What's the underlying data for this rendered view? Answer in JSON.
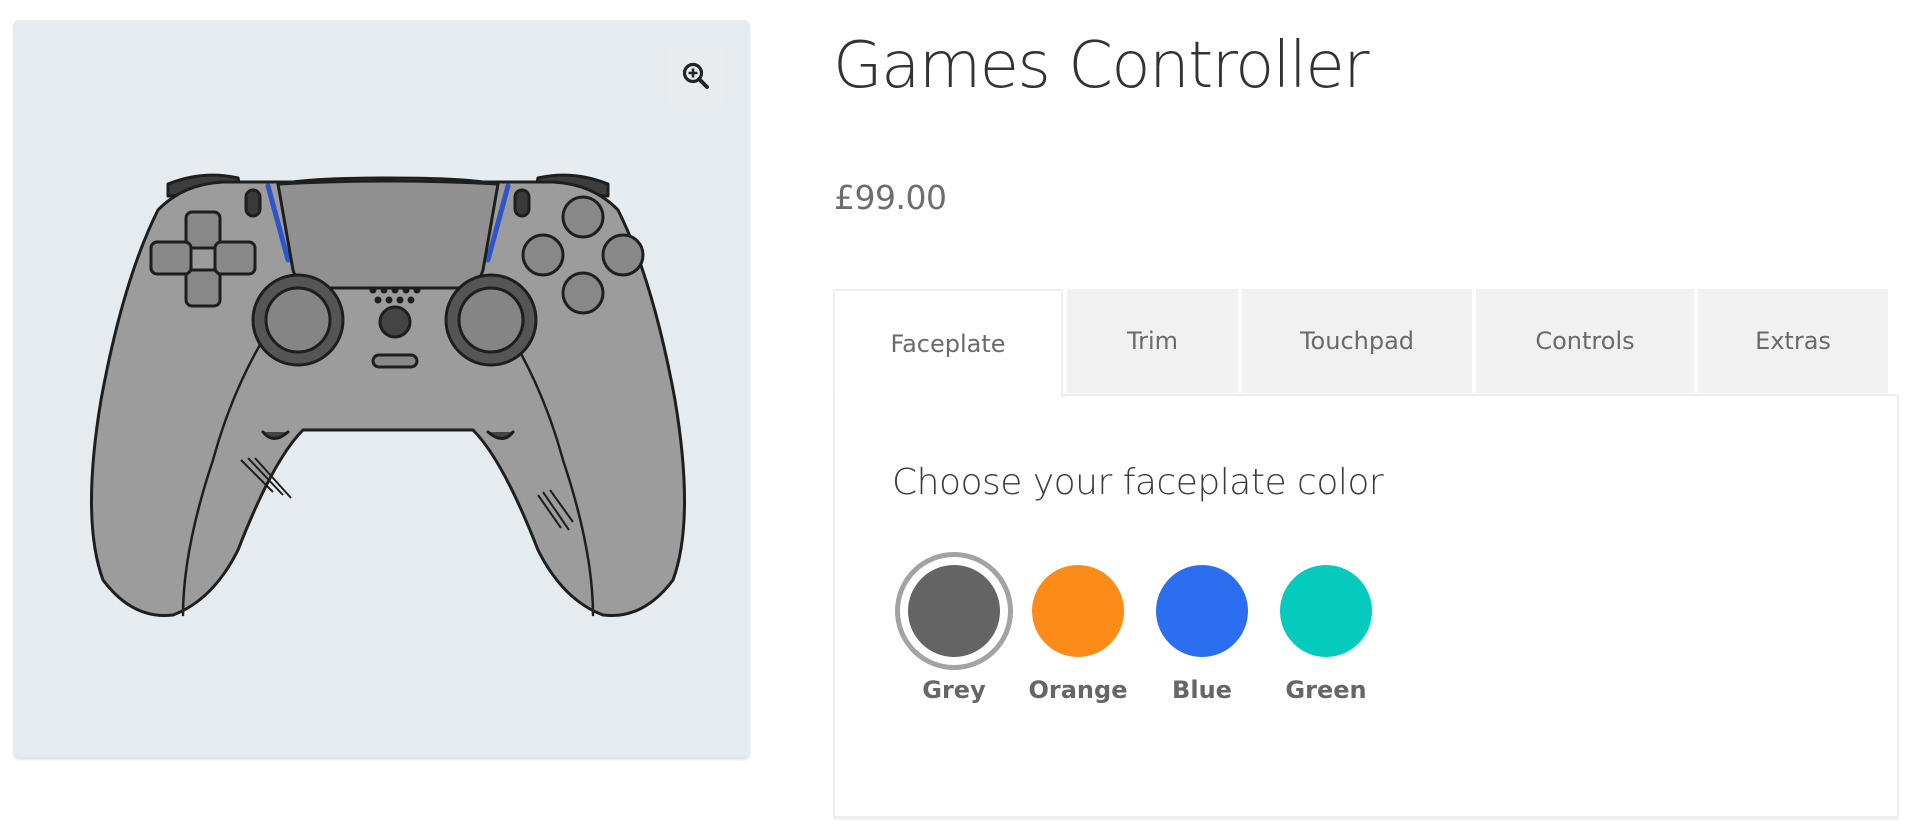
{
  "product": {
    "title": "Games Controller",
    "price": "£99.00",
    "image_alt": "Grey games controller illustration"
  },
  "gallery": {
    "zoom_icon": "zoom-in-icon",
    "background": "#e6ebef"
  },
  "tabs": [
    {
      "label": "Faceplate",
      "active": true
    },
    {
      "label": "Trim",
      "active": false
    },
    {
      "label": "Touchpad",
      "active": false
    },
    {
      "label": "Controls",
      "active": false
    },
    {
      "label": "Extras",
      "active": false
    }
  ],
  "panel": {
    "heading": "Choose your faceplate color",
    "swatches": [
      {
        "label": "Grey",
        "color": "#646464",
        "selected": true
      },
      {
        "label": "Orange",
        "color": "#fb8c1a",
        "selected": false
      },
      {
        "label": "Blue",
        "color": "#2b6ef0",
        "selected": false
      },
      {
        "label": "Green",
        "color": "#05cbbe",
        "selected": false
      }
    ]
  }
}
